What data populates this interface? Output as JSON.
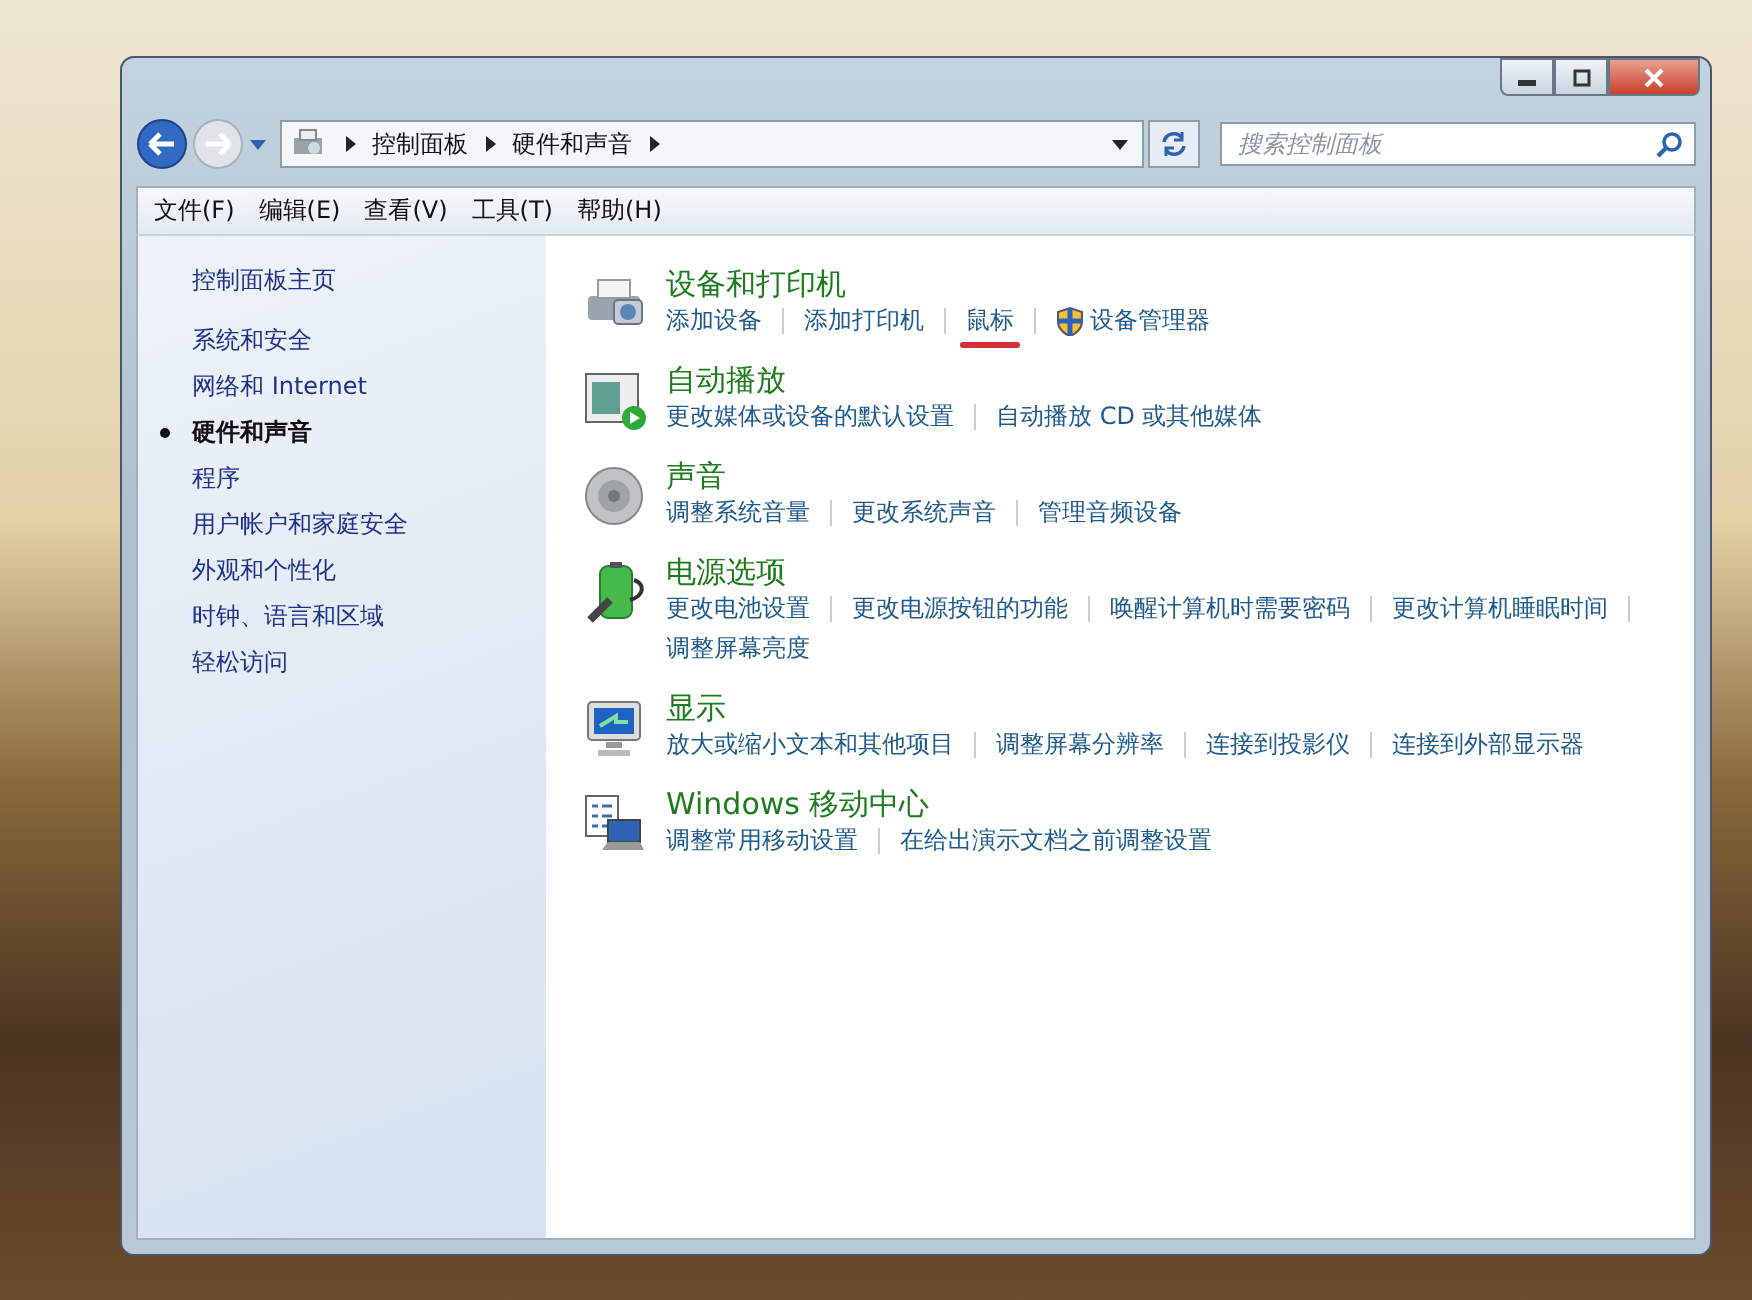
{
  "address_bar": {
    "breadcrumbs": [
      "控制面板",
      "硬件和声音"
    ],
    "search": {
      "placeholder": "搜索控制面板"
    }
  },
  "menu_bar": [
    "文件(F)",
    "编辑(E)",
    "查看(V)",
    "工具(T)",
    "帮助(H)"
  ],
  "sidebar": {
    "home": "控制面板主页",
    "items": [
      {
        "label": "系统和安全",
        "selected": false
      },
      {
        "label": "网络和 Internet",
        "selected": false
      },
      {
        "label": "硬件和声音",
        "selected": true
      },
      {
        "label": "程序",
        "selected": false
      },
      {
        "label": "用户帐户和家庭安全",
        "selected": false
      },
      {
        "label": "外观和个性化",
        "selected": false
      },
      {
        "label": "时钟、语言和区域",
        "selected": false
      },
      {
        "label": "轻松访问",
        "selected": false
      }
    ]
  },
  "sections": [
    {
      "kind": "printer",
      "title": "设备和打印机",
      "links": [
        {
          "text": "添加设备",
          "shield": false,
          "underlined": false
        },
        {
          "text": "添加打印机",
          "shield": false,
          "underlined": false
        },
        {
          "text": "鼠标",
          "shield": false,
          "underlined": true
        },
        {
          "text": "设备管理器",
          "shield": true,
          "underlined": false
        }
      ]
    },
    {
      "kind": "autoplay",
      "title": "自动播放",
      "links": [
        {
          "text": "更改媒体或设备的默认设置",
          "shield": false,
          "underlined": false
        },
        {
          "text": "自动播放 CD 或其他媒体",
          "shield": false,
          "underlined": false
        }
      ]
    },
    {
      "kind": "speaker",
      "title": "声音",
      "links": [
        {
          "text": "调整系统音量",
          "shield": false,
          "underlined": false
        },
        {
          "text": "更改系统声音",
          "shield": false,
          "underlined": false
        },
        {
          "text": "管理音频设备",
          "shield": false,
          "underlined": false
        }
      ]
    },
    {
      "kind": "power",
      "title": "电源选项",
      "links": [
        {
          "text": "更改电池设置",
          "shield": false,
          "underlined": false
        },
        {
          "text": "更改电源按钮的功能",
          "shield": false,
          "underlined": false
        },
        {
          "text": "唤醒计算机时需要密码",
          "shield": false,
          "underlined": false
        },
        {
          "text": "更改计算机睡眠时间",
          "shield": false,
          "underlined": false
        },
        {
          "text": "调整屏幕亮度",
          "shield": false,
          "underlined": false
        }
      ]
    },
    {
      "kind": "display",
      "title": "显示",
      "links": [
        {
          "text": "放大或缩小文本和其他项目",
          "shield": false,
          "underlined": false
        },
        {
          "text": "调整屏幕分辨率",
          "shield": false,
          "underlined": false
        },
        {
          "text": "连接到投影仪",
          "shield": false,
          "underlined": false
        },
        {
          "text": "连接到外部显示器",
          "shield": false,
          "underlined": false
        }
      ]
    },
    {
      "kind": "mobility",
      "title": "Windows 移动中心",
      "links": [
        {
          "text": "调整常用移动设置",
          "shield": false,
          "underlined": false
        },
        {
          "text": "在给出演示文档之前调整设置",
          "shield": false,
          "underlined": false
        }
      ]
    }
  ]
}
